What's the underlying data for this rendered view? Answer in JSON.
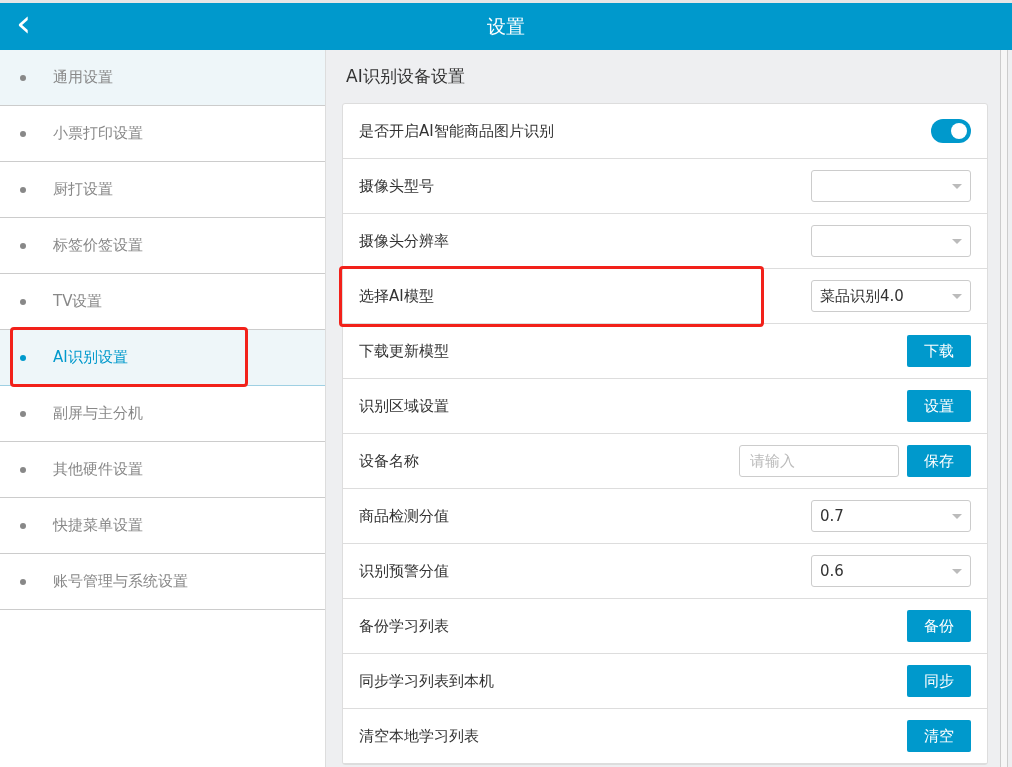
{
  "header": {
    "title": "设置",
    "back": "‹"
  },
  "sidebar": {
    "items": [
      {
        "label": "通用设置",
        "selected": false,
        "highlighted": true,
        "annotated": false
      },
      {
        "label": "小票打印设置",
        "selected": false,
        "highlighted": false,
        "annotated": false
      },
      {
        "label": "厨打设置",
        "selected": false,
        "highlighted": false,
        "annotated": false
      },
      {
        "label": "标签价签设置",
        "selected": false,
        "highlighted": false,
        "annotated": false
      },
      {
        "label": "TV设置",
        "selected": false,
        "highlighted": false,
        "annotated": false
      },
      {
        "label": "AI识别设置",
        "selected": true,
        "highlighted": false,
        "annotated": true
      },
      {
        "label": "副屏与主分机",
        "selected": false,
        "highlighted": false,
        "annotated": false
      },
      {
        "label": "其他硬件设置",
        "selected": false,
        "highlighted": false,
        "annotated": false
      },
      {
        "label": "快捷菜单设置",
        "selected": false,
        "highlighted": false,
        "annotated": false
      },
      {
        "label": "账号管理与系统设置",
        "selected": false,
        "highlighted": false,
        "annotated": false
      }
    ]
  },
  "section": {
    "title": "AI识别设备设置",
    "rows": [
      {
        "kind": "toggle",
        "label": "是否开启AI智能商品图片识别",
        "on": true,
        "annotated": false
      },
      {
        "kind": "select",
        "label": "摄像头型号",
        "value": "",
        "annotated": false
      },
      {
        "kind": "select",
        "label": "摄像头分辨率",
        "value": "",
        "annotated": false
      },
      {
        "kind": "select",
        "label": "选择AI模型",
        "value": "菜品识别4.0",
        "annotated": true
      },
      {
        "kind": "button",
        "label": "下载更新模型",
        "button": "下载",
        "annotated": false
      },
      {
        "kind": "button",
        "label": "识别区域设置",
        "button": "设置",
        "annotated": false
      },
      {
        "kind": "input",
        "label": "设备名称",
        "placeholder": "请输入",
        "button": "保存",
        "annotated": false
      },
      {
        "kind": "select",
        "label": "商品检测分值",
        "value": "0.7",
        "annotated": false
      },
      {
        "kind": "select",
        "label": "识别预警分值",
        "value": "0.6",
        "annotated": false
      },
      {
        "kind": "button",
        "label": "备份学习列表",
        "button": "备份",
        "annotated": false
      },
      {
        "kind": "button",
        "label": "同步学习列表到本机",
        "button": "同步",
        "annotated": false
      },
      {
        "kind": "button",
        "label": "清空本地学习列表",
        "button": "清空",
        "annotated": false
      }
    ]
  }
}
